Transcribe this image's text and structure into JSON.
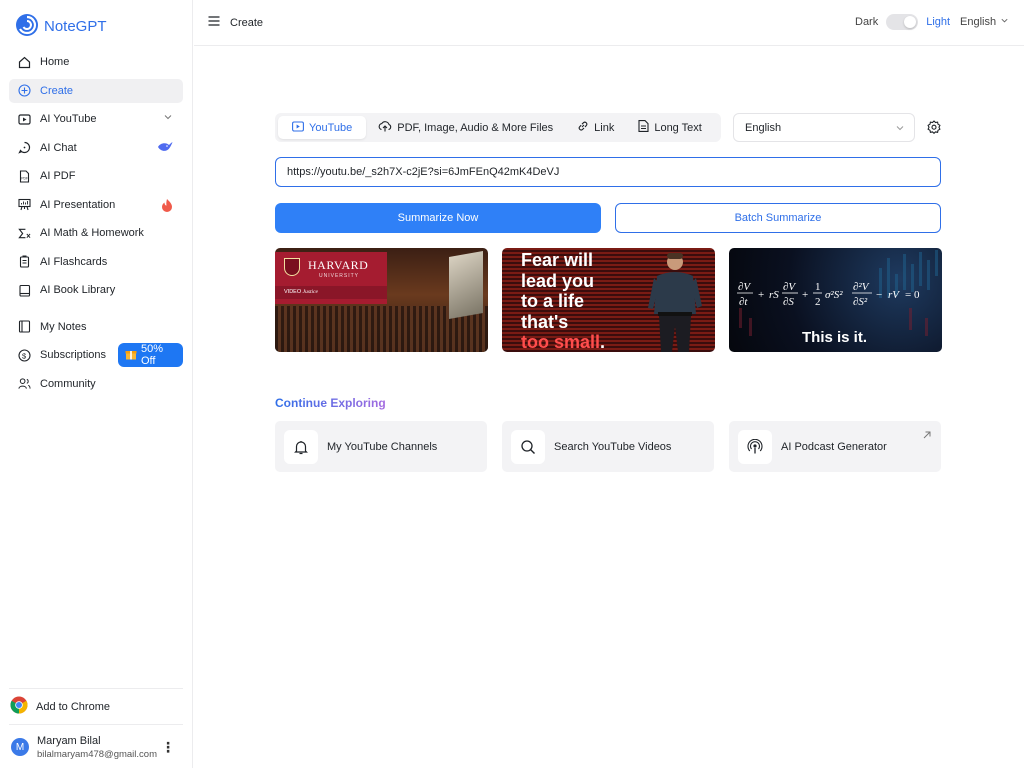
{
  "brand": {
    "name": "NoteGPT",
    "logo_icon": "swirl-logo-icon",
    "color": "#2f6fe8"
  },
  "sidebar": {
    "items": [
      {
        "label": "Home",
        "icon": "home-icon"
      },
      {
        "label": "Create",
        "icon": "plus-circle-icon",
        "active": true
      },
      {
        "label": "AI YouTube",
        "icon": "play-square-icon",
        "has_chevron": true
      },
      {
        "label": "AI Chat",
        "icon": "chat-icon"
      },
      {
        "label": "AI PDF",
        "icon": "pdf-icon"
      },
      {
        "label": "AI Presentation",
        "icon": "presentation-icon",
        "badge_icon": "flame-icon"
      },
      {
        "label": "AI Math & Homework",
        "icon": "sigma-icon"
      },
      {
        "label": "AI Flashcards",
        "icon": "flashcards-icon"
      },
      {
        "label": "AI Book Library",
        "icon": "book-icon"
      },
      {
        "label": "My Notes",
        "icon": "notes-icon"
      },
      {
        "label": "Subscriptions",
        "icon": "dollar-circle-icon"
      },
      {
        "label": "Community",
        "icon": "users-icon"
      }
    ],
    "promo_label": "50% Off",
    "add_to_chrome": "Add to Chrome",
    "user": {
      "initial": "M",
      "name": "Maryam Bilal",
      "email": "bilalmaryam478@gmail.com"
    }
  },
  "topbar": {
    "page_title": "Create",
    "theme_dark": "Dark",
    "theme_light": "Light",
    "language": "English"
  },
  "main": {
    "tabs": [
      {
        "label": "YouTube",
        "icon": "play-square-icon",
        "active": true
      },
      {
        "label": "PDF, Image, Audio & More Files",
        "icon": "cloud-upload-icon"
      },
      {
        "label": "Link",
        "icon": "link-icon"
      },
      {
        "label": "Long Text",
        "icon": "document-icon"
      }
    ],
    "language_select": "English",
    "url_value": "https://youtu.be/_s2h7X-c2jE?si=6JmFEnQ42mK4DeVJ",
    "summarize_now": "Summarize Now",
    "batch_summarize": "Batch Summarize",
    "thumbnails": {
      "harvard": {
        "title": "HARVARD",
        "subtitle": "UNIVERSITY",
        "video_label": "VIDEO",
        "series": "Justice"
      },
      "fear": {
        "lines": [
          "Fear will",
          "lead you",
          "to a life",
          "that's"
        ],
        "highlight": "too small",
        "trail": "."
      },
      "math": {
        "caption": "This is it."
      }
    },
    "explore_title": "Continue Exploring",
    "cards": [
      {
        "label": "My YouTube Channels",
        "icon": "bell-icon"
      },
      {
        "label": "Search YouTube Videos",
        "icon": "search-icon"
      },
      {
        "label": "AI Podcast Generator",
        "icon": "podcast-icon",
        "external": true
      }
    ]
  }
}
